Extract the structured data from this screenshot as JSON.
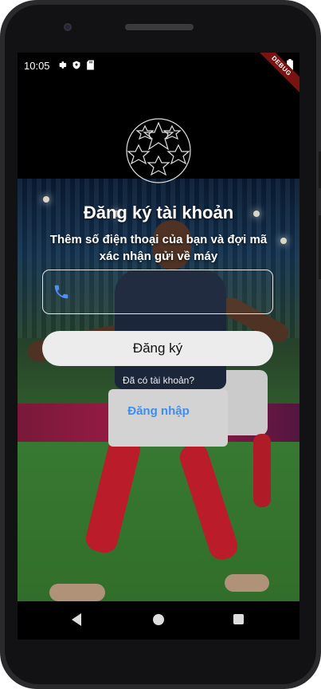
{
  "status_bar": {
    "time": "10:05",
    "left_icons": [
      "gear-icon",
      "shield-icon",
      "sd-card-icon"
    ],
    "right_icons": [
      "wifi-icon",
      "battery-icon"
    ],
    "debug_label": "DEBUG"
  },
  "logo": {
    "icon": "champions-league-star-ball-icon"
  },
  "page": {
    "title": "Đăng ký tài khoản",
    "subtitle": "Thêm số điện thoại của bạn và đợi mã xác nhận gửi về máy"
  },
  "phone_input": {
    "icon": "phone-icon",
    "value": "",
    "placeholder": ""
  },
  "register_button": {
    "label": "Đăng ký"
  },
  "login_prompt": {
    "question": "Đã có tài khoản?",
    "link_label": "Đăng nhập",
    "link_color": "#3d8ef0"
  },
  "nav_bar": {
    "icons": [
      "back-icon",
      "home-icon",
      "recents-icon"
    ]
  }
}
